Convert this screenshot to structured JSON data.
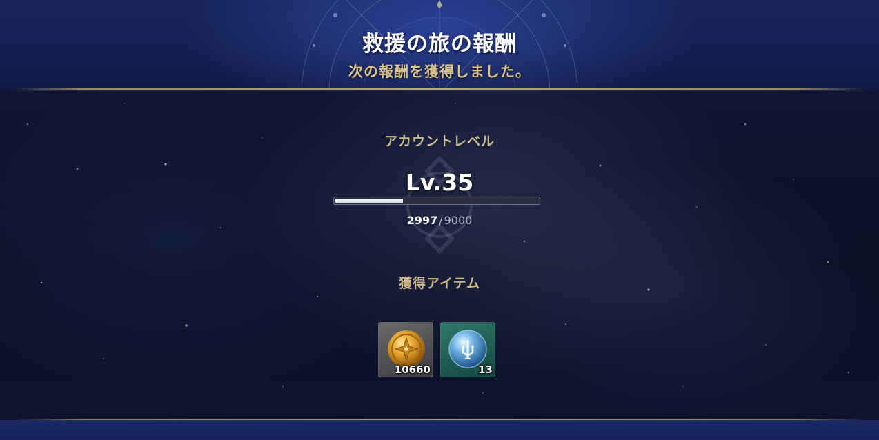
{
  "header": {
    "title": "救援の旅の報酬",
    "subtitle": "次の報酬を獲得しました。"
  },
  "account": {
    "label": "アカウントレベル",
    "level_text": "Lv.35",
    "exp_current": "2997",
    "exp_separator": "/",
    "exp_max": "9000",
    "exp_fraction": 0.333
  },
  "items_section": {
    "label": "獲得アイテム",
    "items": [
      {
        "icon": "gold-coin-icon",
        "count": "10660"
      },
      {
        "icon": "blue-orb-icon",
        "count": "13"
      }
    ]
  },
  "colors": {
    "title": "#ffffff",
    "subtitle_gold": "#d8c48e",
    "label_gold": "#cdb98a",
    "divider_gold": "#b9a67a",
    "background": "#0c1124"
  }
}
